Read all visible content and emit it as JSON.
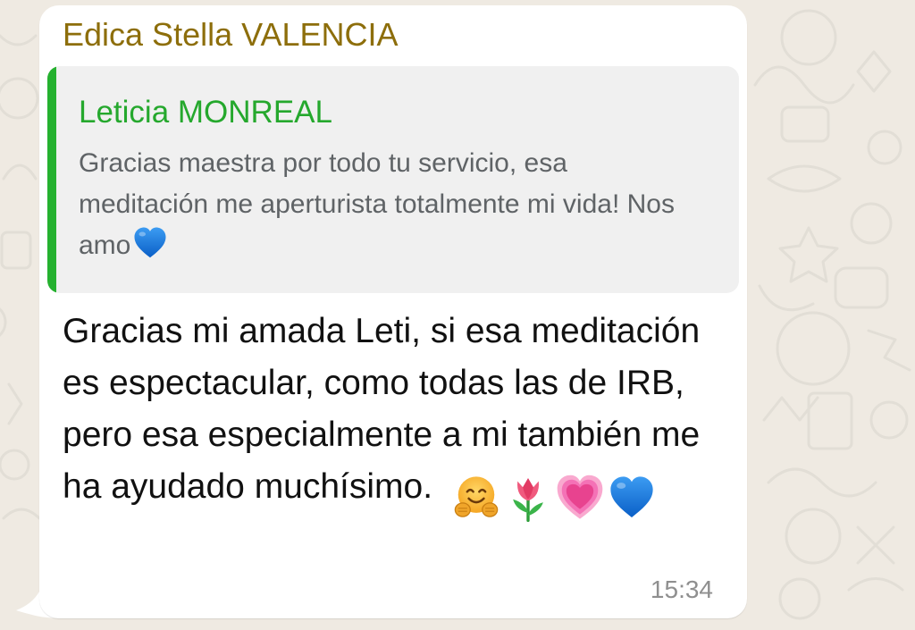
{
  "chat": {
    "sender_name": "Edica Stella VALENCIA",
    "quoted_message": {
      "author": "Leticia MONREAL",
      "text": "Gracias maestra por todo tu servicio, esa meditación me aperturista totalmente mi vida! Nos amo",
      "emoji": "blue-heart"
    },
    "message": {
      "text": "Gracias mi amada Leti, si esa meditación es espectacular, como todas las de IRB, pero esa especialmente a mi también me ha ayudado muchísimo.",
      "emojis": [
        "hugging-face",
        "tulip",
        "growing-heart",
        "blue-heart"
      ],
      "time": "15:34"
    }
  },
  "colors": {
    "wallpaper": "#efeae2",
    "bubble": "#ffffff",
    "sender_name": "#8d6e0b",
    "quote_accent": "#25b12f",
    "quote_background": "#f0f0f0",
    "timestamp": "#8f8f8f"
  }
}
